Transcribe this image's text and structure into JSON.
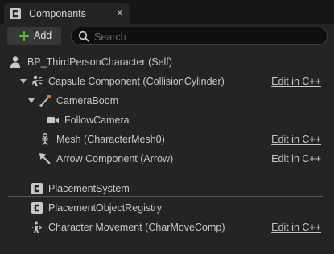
{
  "tab": {
    "title": "Components",
    "close_glyph": "×",
    "icon": "blueprint-c-icon"
  },
  "toolbar": {
    "add_label": "Add",
    "search_placeholder": "Search",
    "search_value": ""
  },
  "tree": {
    "root": {
      "label": "BP_ThirdPersonCharacter (Self)",
      "icon": "pawn-icon"
    },
    "inherited": [
      {
        "label": "Capsule Component (CollisionCylinder)",
        "icon": "capsule-icon",
        "edit": "Edit in C++"
      },
      {
        "label": "CameraBoom",
        "icon": "spring-arm-icon"
      },
      {
        "label": "FollowCamera",
        "icon": "camera-icon"
      },
      {
        "label": "Mesh (CharacterMesh0)",
        "icon": "skeletal-mesh-icon",
        "edit": "Edit in C++"
      },
      {
        "label": "Arrow Component (Arrow)",
        "icon": "arrow-icon",
        "edit": "Edit in C++"
      }
    ],
    "components": [
      {
        "label": "PlacementSystem",
        "icon": "blueprint-c-icon"
      },
      {
        "label": "PlacementObjectRegistry",
        "icon": "blueprint-c-icon"
      },
      {
        "label": "Character Movement (CharMoveComp)",
        "icon": "character-movement-icon",
        "edit": "Edit in C++"
      }
    ]
  },
  "colors": {
    "accent_green": "#5bb832",
    "panel_bg": "#242424",
    "tab_bg": "#242424",
    "link_text": "#c8c8c8"
  }
}
